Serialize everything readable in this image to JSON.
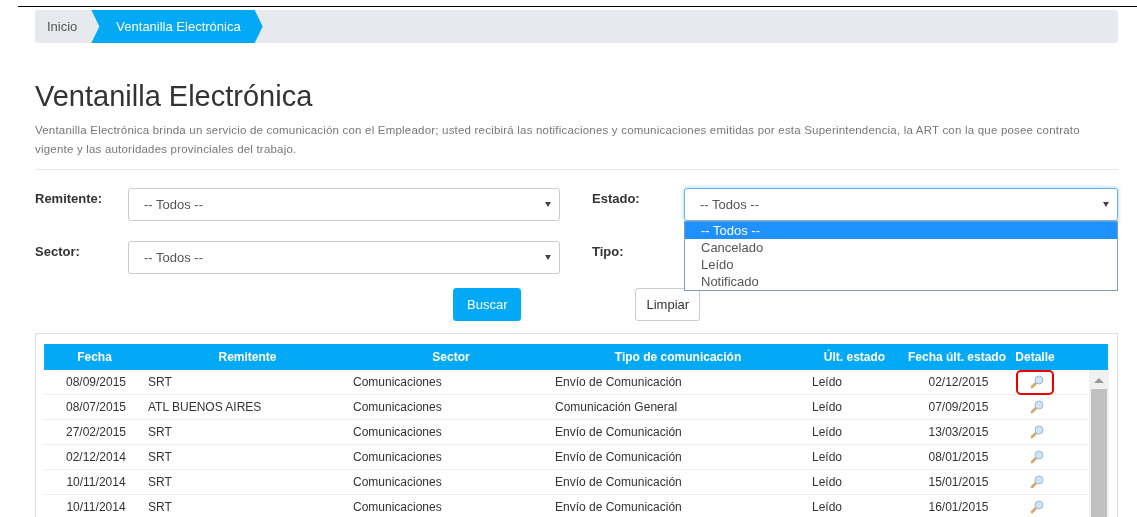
{
  "breadcrumb": [
    {
      "label": "Inicio",
      "selected": false
    },
    {
      "label": "Ventanilla Electrónica",
      "selected": true
    }
  ],
  "title": "Ventanilla Electrónica",
  "description": "Ventanilla Electrónica brinda un servicio de comunicación con el Empleador; usted recibirá las notificaciones y comunicaciones emitidas por esta Superintendencia, la ART con la que posee contrato vigente y las autoridades provinciales del trabajo.",
  "filters": [
    {
      "label": "Remitente:",
      "value": "-- Todos --"
    },
    {
      "label": "Estado:",
      "value": "-- Todos --",
      "expanded": true,
      "options": [
        {
          "label": "-- Todos --",
          "selected": true
        },
        {
          "label": "Cancelado",
          "selected": false
        },
        {
          "label": "Leído",
          "selected": false
        },
        {
          "label": "Notificado",
          "selected": false
        }
      ]
    },
    {
      "label": "Sector:",
      "value": "-- Todos --"
    },
    {
      "label": "Tipo:"
    }
  ],
  "buttons": [
    {
      "label": "Buscar",
      "kind": "primary"
    },
    {
      "label": "Limpiar",
      "kind": "default"
    }
  ],
  "table": {
    "columns": [
      "Fecha",
      "Remitente",
      "Sector",
      "Tipo de comunicación",
      "Últ. estado",
      "Fecha últ. estado",
      "Detalle"
    ],
    "rows": [
      {
        "cells": [
          "08/09/2015",
          "SRT",
          "Comunicaciones",
          "Envío de Comunicación",
          "Leído",
          "02/12/2015"
        ],
        "highlighted": true
      },
      {
        "cells": [
          "08/07/2015",
          "ATL BUENOS AIRES",
          "Comunicaciones",
          "Comunicación General",
          "Leído",
          "07/09/2015"
        ],
        "highlighted": false
      },
      {
        "cells": [
          "27/02/2015",
          "SRT",
          "Comunicaciones",
          "Envío de Comunicación",
          "Leído",
          "13/03/2015"
        ],
        "highlighted": false
      },
      {
        "cells": [
          "02/12/2014",
          "SRT",
          "Comunicaciones",
          "Envío de Comunicación",
          "Leído",
          "08/01/2015"
        ],
        "highlighted": false
      },
      {
        "cells": [
          "10/11/2014",
          "SRT",
          "Comunicaciones",
          "Envío de Comunicación",
          "Leído",
          "15/01/2015"
        ],
        "highlighted": false
      },
      {
        "cells": [
          "10/11/2014",
          "SRT",
          "Comunicaciones",
          "Envío de Comunicación",
          "Leído",
          "16/01/2015"
        ],
        "highlighted": false
      }
    ]
  }
}
